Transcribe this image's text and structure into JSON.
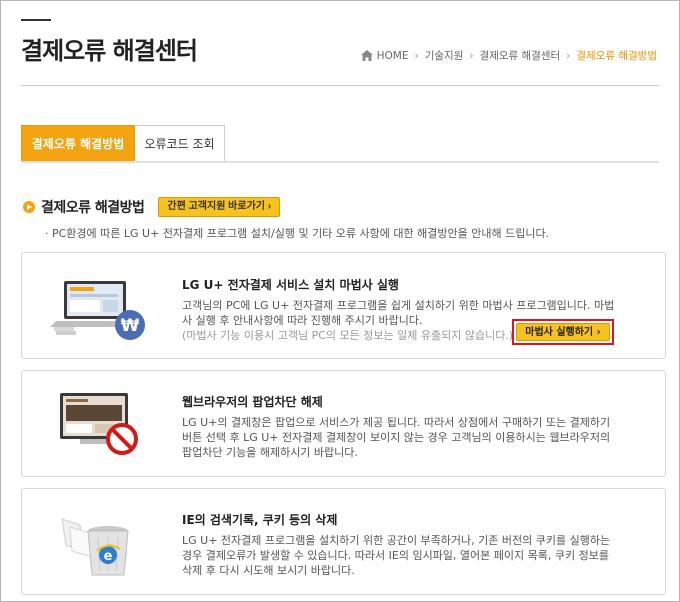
{
  "page": {
    "title": "결제오류 해결센터"
  },
  "breadcrumb": {
    "items": [
      "HOME",
      "기술지원",
      "결제오류 해결센터",
      "결제오류 해결방법"
    ],
    "icon": "home-icon"
  },
  "tabs": [
    {
      "label": "결제오류 해결방법",
      "active": true
    },
    {
      "label": "오류코드 조회",
      "active": false
    }
  ],
  "section": {
    "title": "결제오류 해결방법",
    "cs_button": "간편 고객지원 바로가기 ›",
    "description": "· PC환경에 따른 LG U+ 전자결제 프로그램 설치/실행 및 기타 오류 사항에 대한 해결방안을 안내해 드립니다."
  },
  "cards": [
    {
      "title": "LG U+ 전자결제 서비스 설치 마법사 실행",
      "text": "고객님의 PC에 LG U+ 전자결제 프로그램을 쉽게 설치하기 위한 마법사 프로그램입니다. 마법사 실행 후 안내사항에 따라 진행해 주시기 바랍니다.",
      "note": "(마법사 기능 이용시 고객님 PC의 모든 정보는 일체 유출되지 않습니다.)",
      "button": "마법사 실행하기 ›",
      "icon": "laptop-won-icon"
    },
    {
      "title": "웹브라우저의 팝업차단 해제",
      "text": "LG U+의 결제창은 팝업으로 서비스가 제공 됩니다. 따라서 상점에서 구매하기 또는 결제하기 버튼 선택 후 LG U+ 전자결제 결제창이 보이지 않는 경우 고객님의 이용하시는 웹브라우저의 팝업차단 기능을 해제하시기 바랍니다.",
      "icon": "blocked-browser-icon"
    },
    {
      "title": "IE의 검색기록, 쿠키 등의 삭제",
      "text": "LG U+ 전자결제 프로그램을 설치하기 위한 공간이 부족하거나, 기존 버전의 쿠키를 실행하는 경우 결제오류가 발생할 수 있습니다. 따라서 IE의 임시파일, 열어본 페이지 목록, 쿠키 정보를 삭제 후 다시 시도해 보시기 바랍니다.",
      "icon": "trash-ie-icon"
    }
  ],
  "colors": {
    "accent": "#f2a30f",
    "button": "#f7c21f",
    "highlight_border": "#e0131f"
  }
}
